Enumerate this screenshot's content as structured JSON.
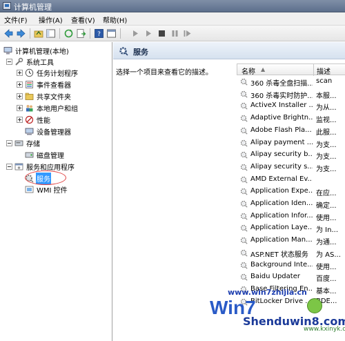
{
  "window": {
    "title": "计算机管理"
  },
  "menu": {
    "file": "文件(F)",
    "action": "操作(A)",
    "view": "查看(V)",
    "help": "帮助(H)"
  },
  "tree": {
    "root": "计算机管理(本地)",
    "system_tools": "系统工具",
    "task_scheduler": "任务计划程序",
    "event_viewer": "事件查看器",
    "shared_folders": "共享文件夹",
    "local_users_groups": "本地用户和组",
    "performance": "性能",
    "device_manager": "设备管理器",
    "storage": "存储",
    "disk_management": "磁盘管理",
    "services_apps": "服务和应用程序",
    "services": "服务",
    "wmi_control": "WMI 控件"
  },
  "panel": {
    "title": "服务",
    "description": "选择一个项目来查看它的描述。",
    "col_name": "名称",
    "col_desc": "描述"
  },
  "services": [
    {
      "name": "360 杀毒全盘扫描...",
      "desc": "scan"
    },
    {
      "name": "360 杀毒实时防护...",
      "desc": "本服..."
    },
    {
      "name": "ActiveX Installer ...",
      "desc": "为从..."
    },
    {
      "name": "Adaptive Brightn...",
      "desc": "监视..."
    },
    {
      "name": "Adobe Flash Pla...",
      "desc": "此服..."
    },
    {
      "name": "Alipay payment ...",
      "desc": "为支..."
    },
    {
      "name": "Alipay security b...",
      "desc": "为支..."
    },
    {
      "name": "Alipay security s...",
      "desc": "为支..."
    },
    {
      "name": "AMD External Ev...",
      "desc": ""
    },
    {
      "name": "Application Expe...",
      "desc": "在应..."
    },
    {
      "name": "Application Iden...",
      "desc": "确定..."
    },
    {
      "name": "Application Infor...",
      "desc": "使用..."
    },
    {
      "name": "Application Laye...",
      "desc": "为 In..."
    },
    {
      "name": "Application Man...",
      "desc": "为通..."
    },
    {
      "name": "ASP.NET 状态服务",
      "desc": "为 AS..."
    },
    {
      "name": "Background Inte...",
      "desc": "使用..."
    },
    {
      "name": "Baidu Updater",
      "desc": "百度..."
    },
    {
      "name": "Base Filtering En...",
      "desc": "基本..."
    },
    {
      "name": "BitLocker Drive ...",
      "desc": "BDE..."
    }
  ],
  "watermark": {
    "url": "www.win7zhijia.cn",
    "brand_big": "Win7",
    "brand": "Shenduwin8.com",
    "site": "www.kxinyk.com"
  }
}
